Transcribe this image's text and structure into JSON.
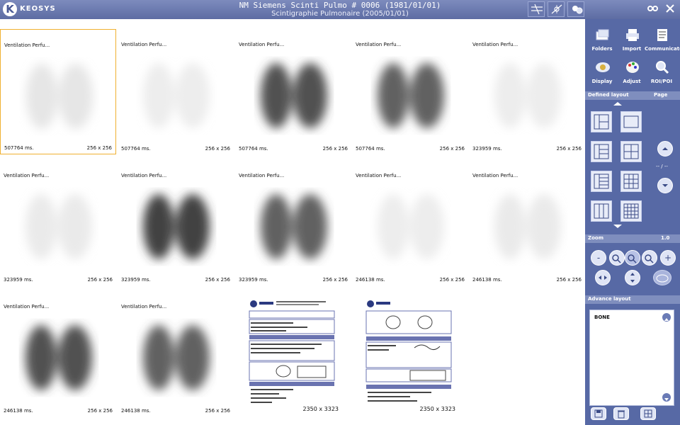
{
  "app": {
    "brand": "KEOSYS",
    "title": "NM Siemens Scinti Pulmo # 0006 (1981/01/01)",
    "subtitle": "Scintigraphie Pulmonaire (2005/01/01)"
  },
  "colors": {
    "accent": "#5769a5",
    "selection": "#f0b030",
    "header": "#7f8ebe"
  },
  "toolbar": {
    "buttons": [
      {
        "icon": "layout-lines-icon"
      },
      {
        "icon": "crosshair-icon"
      },
      {
        "icon": "zoom-person-icon"
      },
      {
        "icon": "settings-icon"
      },
      {
        "icon": "close-icon"
      }
    ]
  },
  "viewer": {
    "cells": [
      {
        "label": "Ventilation Perfu...",
        "time": "507764 ms.",
        "size": "256 x 256",
        "density": 0.15
      },
      {
        "label": "Ventilation Perfu...",
        "time": "507764 ms.",
        "size": "256 x 256",
        "density": 0.1
      },
      {
        "label": "Ventilation Perfu...",
        "time": "507764 ms.",
        "size": "256 x 256",
        "density": 0.85
      },
      {
        "label": "Ventilation Perfu...",
        "time": "507764 ms.",
        "size": "256 x 256",
        "density": 0.8
      },
      {
        "label": "Ventilation Perfu...",
        "time": "323959 ms.",
        "size": "256 x 256",
        "density": 0.1
      },
      {
        "label": "Ventilation Perfu...",
        "time": "323959 ms.",
        "size": "256 x 256",
        "density": 0.12
      },
      {
        "label": "Ventilation Perfu...",
        "time": "323959 ms.",
        "size": "256 x 256",
        "density": 0.9
      },
      {
        "label": "Ventilation Perfu...",
        "time": "323959 ms.",
        "size": "256 x 256",
        "density": 0.8
      },
      {
        "label": "Ventilation Perfu...",
        "time": "246138 ms.",
        "size": "256 x 256",
        "density": 0.1
      },
      {
        "label": "Ventilation Perfu...",
        "time": "246138 ms.",
        "size": "256 x 256",
        "density": 0.12
      },
      {
        "label": "Ventilation Perfu...",
        "time": "246138 ms.",
        "size": "256 x 256",
        "density": 0.85
      },
      {
        "label": "Ventilation Perfu...",
        "time": "246138 ms.",
        "size": "256 x 256",
        "density": 0.8
      }
    ],
    "documents": [
      {
        "size": "2350 x 3323"
      },
      {
        "size": "2350 x 3323"
      }
    ]
  },
  "panel": {
    "tools": [
      {
        "label": "Folders",
        "icon": "folders-icon"
      },
      {
        "label": "Import",
        "icon": "printer-icon"
      },
      {
        "label": "Communicate",
        "icon": "document-icon"
      },
      {
        "label": "Display",
        "icon": "eye-icon"
      },
      {
        "label": "Adjust",
        "icon": "palette-icon"
      },
      {
        "label": "ROI/POI",
        "icon": "magnifier-icon"
      }
    ],
    "defined_layout": {
      "title": "Defined layout",
      "page_label": "Page",
      "page_value": "-- / --"
    },
    "zoom": {
      "title": "Zoom",
      "value": "1.0"
    },
    "advance_layout": {
      "title": "Advance layout",
      "items": [
        "BONE"
      ]
    }
  }
}
